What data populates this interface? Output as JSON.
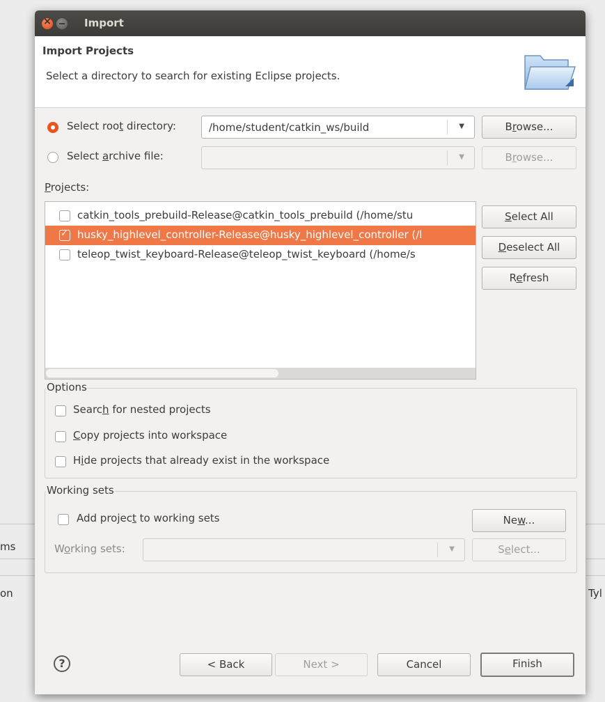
{
  "background": {
    "fragment_left_1": "ms",
    "fragment_left_2": "on",
    "fragment_right": "Tyl"
  },
  "dialog": {
    "title": "Import",
    "header_title": "Import Projects",
    "header_description": "Select a directory to search for existing Eclipse projects."
  },
  "source": {
    "root_directory_label": "Select root directory:",
    "root_directory_value": "/home/student/catkin_ws/build",
    "root_browse": "Browse...",
    "archive_label": "Select archive file:",
    "archive_value": "",
    "archive_browse": "Browse..."
  },
  "projects": {
    "label": "Projects:",
    "items": [
      {
        "text": "catkin_tools_prebuild-Release@catkin_tools_prebuild (/home/stu",
        "checked": false
      },
      {
        "text": "husky_highlevel_controller-Release@husky_highlevel_controller (/l",
        "checked": true
      },
      {
        "text": "teleop_twist_keyboard-Release@teleop_twist_keyboard (/home/s",
        "checked": false
      }
    ],
    "select_all": "Select All",
    "deselect_all": "Deselect All",
    "refresh": "Refresh"
  },
  "options": {
    "group_label": "Options",
    "nested": "Search for nested projects",
    "copy": "Copy projects into workspace",
    "hide": "Hide projects that already exist in the workspace"
  },
  "working_sets": {
    "group_label": "Working sets",
    "add_label": "Add project to working sets",
    "new_button": "New...",
    "sets_label": "Working sets:",
    "sets_value": "",
    "select_button": "Select..."
  },
  "footer": {
    "help": "?",
    "back": "< Back",
    "next": "Next >",
    "cancel": "Cancel",
    "finish": "Finish"
  },
  "colors": {
    "accent": "#e95420",
    "selection": "#f07746"
  }
}
